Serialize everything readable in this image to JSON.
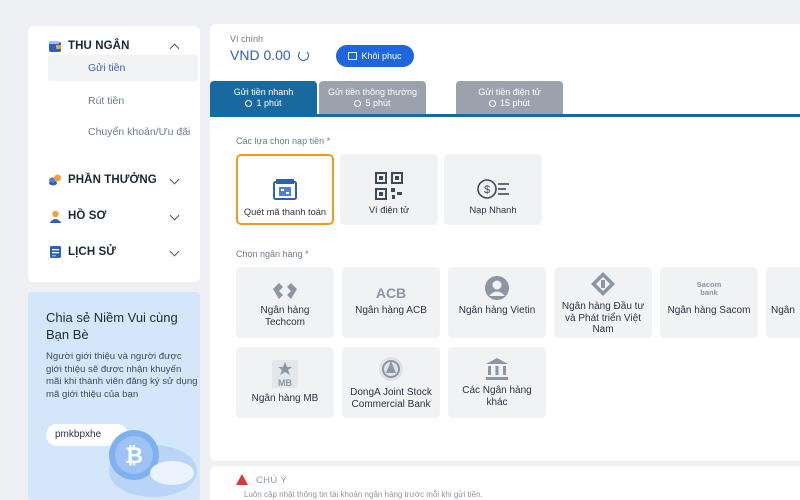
{
  "sidebar": {
    "sections": [
      {
        "label": "THU NGÂN",
        "icon": "wallet-icon"
      },
      {
        "label": "PHẦN THƯỞNG",
        "icon": "coins-icon"
      },
      {
        "label": "HỒ SƠ",
        "icon": "user-icon"
      },
      {
        "label": "LỊCH SỬ",
        "icon": "history-icon"
      }
    ],
    "sub_items": [
      "Gửi tiền",
      "Rút tiền",
      "Chuyển khoản/Ưu đãi"
    ]
  },
  "referral": {
    "title": "Chia sẻ Niềm Vui cùng Bạn Bè",
    "description": "Người giới thiệu và người được giới thiệu sẽ được nhận khuyến mãi khi thành viên đăng ký sử dụng mã giới thiệu của bạn",
    "code": "pmkbpxhe"
  },
  "wallet": {
    "label": "Ví chính",
    "value": "VND 0.00",
    "restore_label": "Khôi phục"
  },
  "tabs": [
    {
      "label": "Gửi tiền nhanh",
      "time": "1 phút",
      "active": true
    },
    {
      "label": "Gửi tiền thông thường",
      "time": "5 phút",
      "active": false
    },
    {
      "label": "Gửi tiền điện tử",
      "time": "15 phút",
      "active": false
    }
  ],
  "deposit_options": {
    "label": "Các lựa chọn nạp tiền",
    "required_mark": "*",
    "items": [
      {
        "label": "Quét mã thanh toán",
        "icon": "qr-scan-icon",
        "selected": true
      },
      {
        "label": "Ví điện tử",
        "icon": "qr-code-icon",
        "selected": false
      },
      {
        "label": "Nạp Nhanh",
        "icon": "fast-coin-icon",
        "selected": false
      }
    ]
  },
  "banks": {
    "label": "Chọn ngân hàng",
    "required_mark": "*",
    "items": [
      {
        "label": "Ngân hàng Techcom",
        "icon": "techcombank-logo-icon"
      },
      {
        "label": "Ngân hàng ACB",
        "icon": "acb-logo-icon",
        "logo_text": "ACB"
      },
      {
        "label": "Ngân hàng Vietin",
        "icon": "vietinbank-logo-icon"
      },
      {
        "label": "Ngân hàng Đầu tư và Phát triển Việt Nam",
        "icon": "bidv-logo-icon"
      },
      {
        "label": "Ngân hàng Sacom",
        "icon": "sacombank-logo-icon",
        "logo_text": "Sacom bank"
      },
      {
        "label": "Ngân",
        "icon": "bank-logo-icon"
      },
      {
        "label": "Ngân hàng MB",
        "icon": "mb-logo-icon",
        "logo_text": "MB"
      },
      {
        "label": "DongA Joint Stock Commercial Bank",
        "icon": "donga-logo-icon"
      },
      {
        "label": "Các Ngân hàng khác",
        "icon": "bank-building-icon"
      }
    ]
  },
  "notice": {
    "title": "CHÚ Ý",
    "line": "Luôn cập nhật thông tin tài khoản ngân hàng trước mỗi khi gửi tiền."
  },
  "colors": {
    "accent": "#1f64e0",
    "tab_active": "#17699f",
    "selected_border": "#ee9b1f",
    "warning": "#d63b3b"
  }
}
